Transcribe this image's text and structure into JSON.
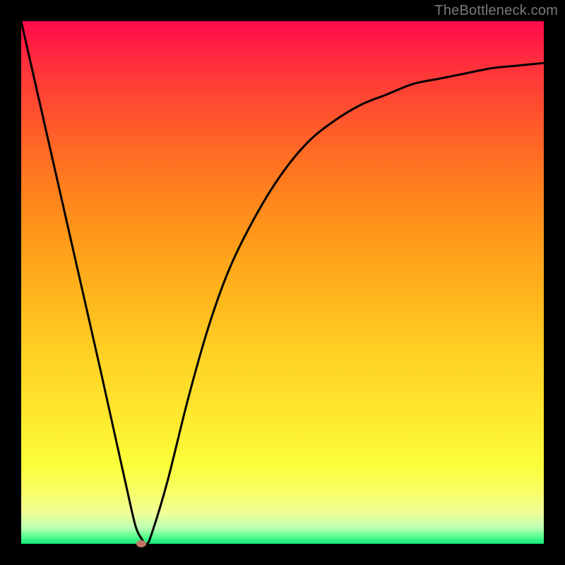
{
  "watermark": "TheBottleneck.com",
  "colors": {
    "curve_stroke": "#000000",
    "marker_fill": "#c17465",
    "frame_bg": "#000000"
  },
  "chart_data": {
    "type": "line",
    "title": "",
    "xlabel": "",
    "ylabel": "",
    "xlim": [
      0,
      100
    ],
    "ylim": [
      0,
      100
    ],
    "grid": false,
    "gradient_stops": [
      {
        "pos": 0.0,
        "color": "#ff0a4b"
      },
      {
        "pos": 0.5,
        "color": "#ffb41c"
      },
      {
        "pos": 0.85,
        "color": "#faff3a"
      },
      {
        "pos": 1.0,
        "color": "#12e87a"
      }
    ],
    "series": [
      {
        "name": "bottleneck-curve",
        "x": [
          0,
          5,
          10,
          15,
          19,
          21,
          22,
          23,
          24,
          25,
          28,
          32,
          36,
          40,
          45,
          50,
          55,
          60,
          65,
          70,
          75,
          80,
          85,
          90,
          95,
          100
        ],
        "y": [
          100,
          78,
          56,
          34,
          16,
          7,
          3,
          1,
          0,
          2,
          12,
          28,
          42,
          53,
          63,
          71,
          77,
          81,
          84,
          86,
          88,
          89,
          90,
          91,
          91.5,
          92
        ]
      }
    ],
    "marker": {
      "x": 23,
      "y": 0
    }
  }
}
